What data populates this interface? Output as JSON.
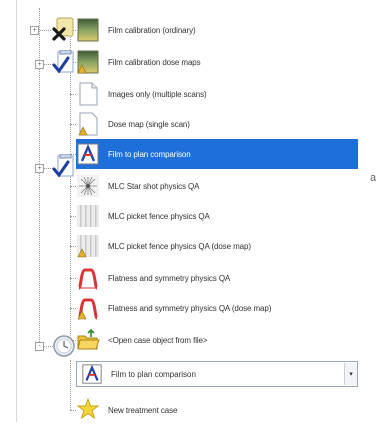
{
  "tree": {
    "groups": [
      {
        "icon": "film-cancel-icon",
        "expander": "+"
      },
      {
        "icon": "checklist-icon",
        "expander": "+"
      },
      {
        "icon": "checklist-icon",
        "expander": "+"
      },
      {
        "icon": "clock-icon",
        "expander": "-"
      }
    ],
    "items": [
      {
        "label": "Film calibration (ordinary)",
        "icon": "film-calibration-icon",
        "selected": false
      },
      {
        "label": "Film calibration dose maps",
        "icon": "film-calibration-dose-icon",
        "selected": false
      },
      {
        "label": "Images only (multiple scans)",
        "icon": "document-icon",
        "selected": false
      },
      {
        "label": "Dose map (single scan)",
        "icon": "dose-map-icon",
        "selected": false
      },
      {
        "label": "Film to plan comparison",
        "icon": "film-plan-icon",
        "selected": true
      },
      {
        "label": "MLC Star shot physics QA",
        "icon": "star-shot-icon",
        "selected": false
      },
      {
        "label": "MLC picket fence physics QA",
        "icon": "picket-fence-icon",
        "selected": false
      },
      {
        "label": "MLC picket fence physics QA (dose map)",
        "icon": "picket-fence-dose-icon",
        "selected": false
      },
      {
        "label": "Flatness and symmetry physics QA",
        "icon": "flatness-icon",
        "selected": false
      },
      {
        "label": "Flatness and symmetry physics QA (dose map)",
        "icon": "flatness-dose-icon",
        "selected": false
      },
      {
        "label": "<Open case object from file>",
        "icon": "open-folder-icon",
        "selected": false
      }
    ],
    "dropdown": {
      "value": "Film to plan comparison",
      "icon": "film-plan-icon"
    },
    "new_case": {
      "label": "New treatment case",
      "icon": "new-case-icon"
    }
  },
  "stray_text": "a",
  "colors": {
    "selection": "#1e6fd9",
    "tree_line": "#9a9a9a"
  }
}
